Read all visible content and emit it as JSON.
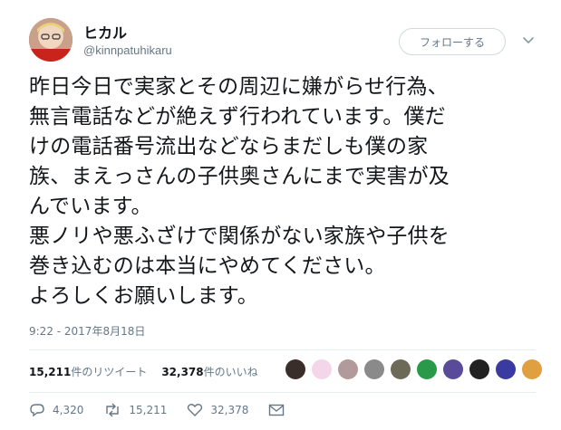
{
  "user": {
    "display_name": "ヒカル",
    "handle": "@kinnpatuhikaru",
    "avatar": "avatar-photo"
  },
  "follow_button": {
    "label": "フォローする"
  },
  "menu_icon": "chevron-down-icon",
  "tweet": {
    "lines": [
      "昨日今日で実家とその周辺に嫌がらせ行為、",
      "無言電話などが絶えず行われています。僕だ",
      "けの電話番号流出などならまだしも僕の家",
      "族、まえっさんの子供奥さんにまで実害が及",
      "んでいます。",
      "悪ノリや悪ふざけで関係がない家族や子供を",
      "巻き込むのは本当にやめてください。",
      "よろしくお願いします。"
    ],
    "timestamp": "9:22 - 2017年8月18日"
  },
  "stats": {
    "retweets_count": "15,211",
    "retweets_label": "件のリツイート",
    "likes_count": "32,378",
    "likes_label": "件のいいね"
  },
  "liker_avatars": [
    {
      "color": "#3a2e2a"
    },
    {
      "color": "#f3d6ea"
    },
    {
      "color": "#b09a9a"
    },
    {
      "color": "#8a8a8a"
    },
    {
      "color": "#6e6a5a"
    },
    {
      "color": "#2a9a4a"
    },
    {
      "color": "#5a4a9a"
    },
    {
      "color": "#222222"
    },
    {
      "color": "#3a3aa0"
    },
    {
      "color": "#e0a040"
    }
  ],
  "actions": {
    "reply_count": "4,320",
    "retweet_count": "15,211",
    "like_count": "32,378"
  },
  "colors": {
    "secondary_text": "#657786",
    "border": "#e6ecf0"
  }
}
